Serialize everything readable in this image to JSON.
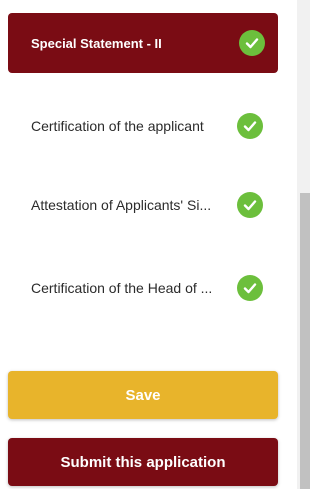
{
  "nav": {
    "items": [
      {
        "label": "Special Statement - II",
        "completed": true,
        "active": true
      },
      {
        "label": "Certification of the applicant",
        "completed": true,
        "active": false
      },
      {
        "label": "Attestation of Applicants' Si...",
        "completed": true,
        "active": false
      },
      {
        "label": "Certification of the Head of ...",
        "completed": true,
        "active": false
      }
    ]
  },
  "actions": {
    "save_label": "Save",
    "submit_label": "Submit this application"
  },
  "colors": {
    "primary": "#7a0c14",
    "save": "#e8b42b",
    "check": "#6cbf3c"
  },
  "icons": {
    "completed": "check-circle-icon"
  }
}
